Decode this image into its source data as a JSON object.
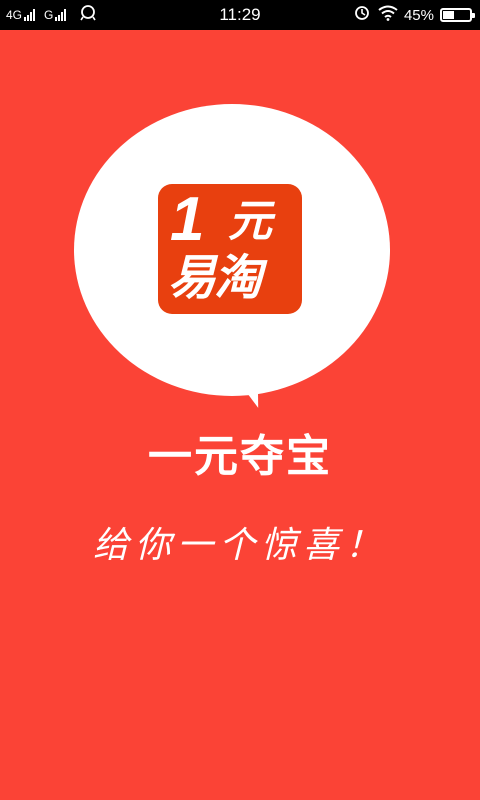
{
  "status_bar": {
    "network1": "4G",
    "network2": "G",
    "time": "11:29",
    "battery_percent": "45%",
    "battery_level": 0.45,
    "icons": [
      "signal-icon",
      "signal-icon",
      "qq-icon",
      "alarm-icon",
      "wifi-icon",
      "battery-icon"
    ]
  },
  "splash": {
    "logo_number": "1",
    "logo_char": "元",
    "logo_name": "易淘",
    "title": "一元夺宝",
    "slogan": "给你一个惊喜！"
  },
  "colors": {
    "background": "#fb4336",
    "logo_bg": "#e8400f",
    "bubble": "#ffffff",
    "text": "#ffffff"
  }
}
